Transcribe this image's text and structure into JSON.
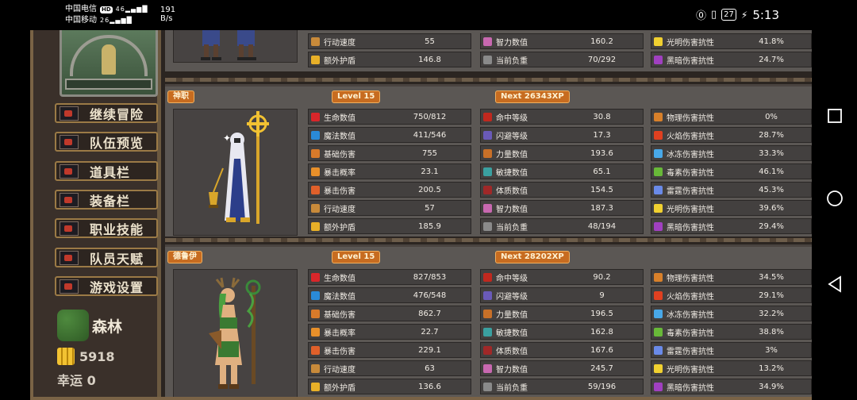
{
  "status_bar": {
    "carrier_1": "中国电信",
    "carrier_1_badge": "HD",
    "carrier_1_signal": "46",
    "carrier_2": "中国移动",
    "carrier_2_signal": "26",
    "net_speed_value": "191",
    "net_speed_unit": "B/s",
    "battery": "27",
    "time": "5:13"
  },
  "sidebar": {
    "menu": [
      {
        "label": "继续冒险"
      },
      {
        "label": "队伍预览"
      },
      {
        "label": "道具栏"
      },
      {
        "label": "装备栏"
      },
      {
        "label": "职业技能"
      },
      {
        "label": "队员天赋"
      },
      {
        "label": "游戏设置"
      }
    ],
    "region": "森林",
    "gold": "5918",
    "luck": "幸运 0"
  },
  "members": [
    {
      "name": "",
      "level": "",
      "next": "",
      "col1": [
        {
          "name": "行动速度",
          "value": "55"
        },
        {
          "name": "额外护盾",
          "value": "146.8"
        }
      ],
      "col2": [
        {
          "name": "智力数值",
          "value": "160.2"
        },
        {
          "name": "当前负重",
          "value": "70/292"
        }
      ],
      "col3": [
        {
          "name": "光明伤害抗性",
          "value": "41.8%"
        },
        {
          "name": "黑暗伤害抗性",
          "value": "24.7%"
        }
      ]
    },
    {
      "name": "神职",
      "level": "Level 15",
      "next": "Next 26343XP",
      "col1": [
        {
          "name": "生命数值",
          "value": "750/812"
        },
        {
          "name": "魔法数值",
          "value": "411/546"
        },
        {
          "name": "基础伤害",
          "value": "755"
        },
        {
          "name": "暴击概率",
          "value": "23.1"
        },
        {
          "name": "暴击伤害",
          "value": "200.5"
        },
        {
          "name": "行动速度",
          "value": "57"
        },
        {
          "name": "额外护盾",
          "value": "185.9"
        }
      ],
      "col2": [
        {
          "name": "命中等级",
          "value": "30.8"
        },
        {
          "name": "闪避等级",
          "value": "17.3"
        },
        {
          "name": "力量数值",
          "value": "193.6"
        },
        {
          "name": "敏捷数值",
          "value": "65.1"
        },
        {
          "name": "体质数值",
          "value": "154.5"
        },
        {
          "name": "智力数值",
          "value": "187.3"
        },
        {
          "name": "当前负重",
          "value": "48/194"
        }
      ],
      "col3": [
        {
          "name": "物理伤害抗性",
          "value": "0%"
        },
        {
          "name": "火焰伤害抗性",
          "value": "28.7%"
        },
        {
          "name": "冰冻伤害抗性",
          "value": "33.3%"
        },
        {
          "name": "毒素伤害抗性",
          "value": "46.1%"
        },
        {
          "name": "雷霆伤害抗性",
          "value": "45.3%"
        },
        {
          "name": "光明伤害抗性",
          "value": "39.6%"
        },
        {
          "name": "黑暗伤害抗性",
          "value": "29.4%"
        }
      ]
    },
    {
      "name": "德鲁伊",
      "level": "Level 15",
      "next": "Next 28202XP",
      "col1": [
        {
          "name": "生命数值",
          "value": "827/853"
        },
        {
          "name": "魔法数值",
          "value": "476/548"
        },
        {
          "name": "基础伤害",
          "value": "862.7"
        },
        {
          "name": "暴击概率",
          "value": "22.7"
        },
        {
          "name": "暴击伤害",
          "value": "229.1"
        },
        {
          "name": "行动速度",
          "value": "63"
        },
        {
          "name": "额外护盾",
          "value": "136.6"
        }
      ],
      "col2": [
        {
          "name": "命中等级",
          "value": "90.2"
        },
        {
          "name": "闪避等级",
          "value": "9"
        },
        {
          "name": "力量数值",
          "value": "196.5"
        },
        {
          "name": "敏捷数值",
          "value": "162.8"
        },
        {
          "name": "体质数值",
          "value": "167.6"
        },
        {
          "name": "智力数值",
          "value": "245.7"
        },
        {
          "name": "当前负重",
          "value": "59/196"
        }
      ],
      "col3": [
        {
          "name": "物理伤害抗性",
          "value": "34.5%"
        },
        {
          "name": "火焰伤害抗性",
          "value": "29.1%"
        },
        {
          "name": "冰冻伤害抗性",
          "value": "32.2%"
        },
        {
          "name": "毒素伤害抗性",
          "value": "38.8%"
        },
        {
          "name": "雷霆伤害抗性",
          "value": "3%"
        },
        {
          "name": "光明伤害抗性",
          "value": "13.2%"
        },
        {
          "name": "黑暗伤害抗性",
          "value": "34.9%"
        }
      ]
    }
  ],
  "stat_icon_colors": {
    "生命数值": "#d8262a",
    "魔法数值": "#2a8ad8",
    "基础伤害": "#d87a2a",
    "暴击概率": "#e8902a",
    "暴击伤害": "#e0602a",
    "行动速度": "#c88a3a",
    "额外护盾": "#e8b028",
    "命中等级": "#c0281e",
    "闪避等级": "#6a5ab8",
    "力量数值": "#c87028",
    "敏捷数值": "#3aa0a0",
    "体质数值": "#a02828",
    "智力数值": "#c868b0",
    "当前负重": "#8a8a8a",
    "物理伤害抗性": "#d8802a",
    "火焰伤害抗性": "#e04020",
    "冰冻伤害抗性": "#48a8e8",
    "毒素伤害抗性": "#68b838",
    "雷霆伤害抗性": "#6a8ae8",
    "光明伤害抗性": "#f0d030",
    "黑暗伤害抗性": "#a040c0"
  }
}
